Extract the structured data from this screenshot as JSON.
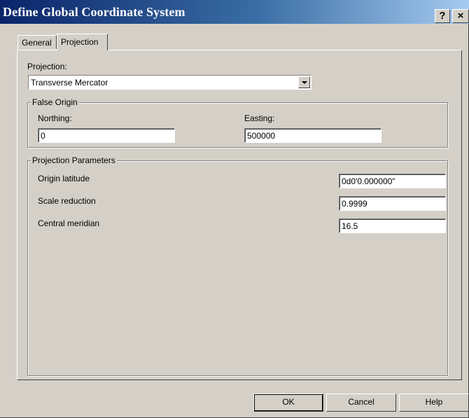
{
  "window": {
    "title": "Define Global Coordinate System",
    "help_button": "?",
    "close_button": "×"
  },
  "tabs": [
    {
      "label": "General",
      "active": false
    },
    {
      "label": "Projection",
      "active": true
    }
  ],
  "projection": {
    "label": "Projection:",
    "selected": "Transverse Mercator"
  },
  "false_origin": {
    "title": "False Origin",
    "northing_label": "Northing:",
    "northing_value": "0",
    "easting_label": "Easting:",
    "easting_value": "500000"
  },
  "projection_parameters": {
    "title": "Projection Parameters",
    "rows": [
      {
        "label": "Origin latitude",
        "value": "0d0'0.000000\""
      },
      {
        "label": "Scale reduction",
        "value": "0.9999"
      },
      {
        "label": "Central meridian",
        "value": "16.5"
      }
    ]
  },
  "buttons": {
    "ok": "OK",
    "cancel": "Cancel",
    "help": "Help"
  },
  "colors": {
    "titlebar_start": "#0a246a",
    "titlebar_end": "#a6caf0",
    "dialog_face": "#d4d0c8"
  }
}
